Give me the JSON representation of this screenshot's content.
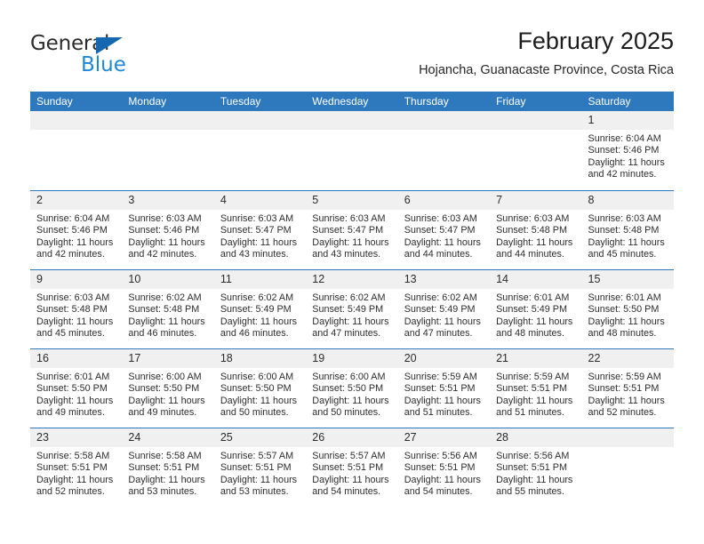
{
  "brand": {
    "name_top": "General",
    "name_bottom": "Blue",
    "triangle_icon": "triangle-icon",
    "accent_color": "#1f88d8",
    "triangle_color": "#1567b2"
  },
  "header": {
    "month_title": "February 2025",
    "location": "Hojancha, Guanacaste Province, Costa Rica"
  },
  "calendar": {
    "header_bg": "#2e79be",
    "day_band_bg": "#f0f0f0",
    "weekdays": [
      "Sunday",
      "Monday",
      "Tuesday",
      "Wednesday",
      "Thursday",
      "Friday",
      "Saturday"
    ],
    "weeks": [
      [
        {
          "empty": true
        },
        {
          "empty": true
        },
        {
          "empty": true
        },
        {
          "empty": true
        },
        {
          "empty": true
        },
        {
          "empty": true
        },
        {
          "day": "1",
          "sunrise": "Sunrise: 6:04 AM",
          "sunset": "Sunset: 5:46 PM",
          "daylight": "Daylight: 11 hours and 42 minutes."
        }
      ],
      [
        {
          "day": "2",
          "sunrise": "Sunrise: 6:04 AM",
          "sunset": "Sunset: 5:46 PM",
          "daylight": "Daylight: 11 hours and 42 minutes."
        },
        {
          "day": "3",
          "sunrise": "Sunrise: 6:03 AM",
          "sunset": "Sunset: 5:46 PM",
          "daylight": "Daylight: 11 hours and 42 minutes."
        },
        {
          "day": "4",
          "sunrise": "Sunrise: 6:03 AM",
          "sunset": "Sunset: 5:47 PM",
          "daylight": "Daylight: 11 hours and 43 minutes."
        },
        {
          "day": "5",
          "sunrise": "Sunrise: 6:03 AM",
          "sunset": "Sunset: 5:47 PM",
          "daylight": "Daylight: 11 hours and 43 minutes."
        },
        {
          "day": "6",
          "sunrise": "Sunrise: 6:03 AM",
          "sunset": "Sunset: 5:47 PM",
          "daylight": "Daylight: 11 hours and 44 minutes."
        },
        {
          "day": "7",
          "sunrise": "Sunrise: 6:03 AM",
          "sunset": "Sunset: 5:48 PM",
          "daylight": "Daylight: 11 hours and 44 minutes."
        },
        {
          "day": "8",
          "sunrise": "Sunrise: 6:03 AM",
          "sunset": "Sunset: 5:48 PM",
          "daylight": "Daylight: 11 hours and 45 minutes."
        }
      ],
      [
        {
          "day": "9",
          "sunrise": "Sunrise: 6:03 AM",
          "sunset": "Sunset: 5:48 PM",
          "daylight": "Daylight: 11 hours and 45 minutes."
        },
        {
          "day": "10",
          "sunrise": "Sunrise: 6:02 AM",
          "sunset": "Sunset: 5:48 PM",
          "daylight": "Daylight: 11 hours and 46 minutes."
        },
        {
          "day": "11",
          "sunrise": "Sunrise: 6:02 AM",
          "sunset": "Sunset: 5:49 PM",
          "daylight": "Daylight: 11 hours and 46 minutes."
        },
        {
          "day": "12",
          "sunrise": "Sunrise: 6:02 AM",
          "sunset": "Sunset: 5:49 PM",
          "daylight": "Daylight: 11 hours and 47 minutes."
        },
        {
          "day": "13",
          "sunrise": "Sunrise: 6:02 AM",
          "sunset": "Sunset: 5:49 PM",
          "daylight": "Daylight: 11 hours and 47 minutes."
        },
        {
          "day": "14",
          "sunrise": "Sunrise: 6:01 AM",
          "sunset": "Sunset: 5:49 PM",
          "daylight": "Daylight: 11 hours and 48 minutes."
        },
        {
          "day": "15",
          "sunrise": "Sunrise: 6:01 AM",
          "sunset": "Sunset: 5:50 PM",
          "daylight": "Daylight: 11 hours and 48 minutes."
        }
      ],
      [
        {
          "day": "16",
          "sunrise": "Sunrise: 6:01 AM",
          "sunset": "Sunset: 5:50 PM",
          "daylight": "Daylight: 11 hours and 49 minutes."
        },
        {
          "day": "17",
          "sunrise": "Sunrise: 6:00 AM",
          "sunset": "Sunset: 5:50 PM",
          "daylight": "Daylight: 11 hours and 49 minutes."
        },
        {
          "day": "18",
          "sunrise": "Sunrise: 6:00 AM",
          "sunset": "Sunset: 5:50 PM",
          "daylight": "Daylight: 11 hours and 50 minutes."
        },
        {
          "day": "19",
          "sunrise": "Sunrise: 6:00 AM",
          "sunset": "Sunset: 5:50 PM",
          "daylight": "Daylight: 11 hours and 50 minutes."
        },
        {
          "day": "20",
          "sunrise": "Sunrise: 5:59 AM",
          "sunset": "Sunset: 5:51 PM",
          "daylight": "Daylight: 11 hours and 51 minutes."
        },
        {
          "day": "21",
          "sunrise": "Sunrise: 5:59 AM",
          "sunset": "Sunset: 5:51 PM",
          "daylight": "Daylight: 11 hours and 51 minutes."
        },
        {
          "day": "22",
          "sunrise": "Sunrise: 5:59 AM",
          "sunset": "Sunset: 5:51 PM",
          "daylight": "Daylight: 11 hours and 52 minutes."
        }
      ],
      [
        {
          "day": "23",
          "sunrise": "Sunrise: 5:58 AM",
          "sunset": "Sunset: 5:51 PM",
          "daylight": "Daylight: 11 hours and 52 minutes."
        },
        {
          "day": "24",
          "sunrise": "Sunrise: 5:58 AM",
          "sunset": "Sunset: 5:51 PM",
          "daylight": "Daylight: 11 hours and 53 minutes."
        },
        {
          "day": "25",
          "sunrise": "Sunrise: 5:57 AM",
          "sunset": "Sunset: 5:51 PM",
          "daylight": "Daylight: 11 hours and 53 minutes."
        },
        {
          "day": "26",
          "sunrise": "Sunrise: 5:57 AM",
          "sunset": "Sunset: 5:51 PM",
          "daylight": "Daylight: 11 hours and 54 minutes."
        },
        {
          "day": "27",
          "sunrise": "Sunrise: 5:56 AM",
          "sunset": "Sunset: 5:51 PM",
          "daylight": "Daylight: 11 hours and 54 minutes."
        },
        {
          "day": "28",
          "sunrise": "Sunrise: 5:56 AM",
          "sunset": "Sunset: 5:51 PM",
          "daylight": "Daylight: 11 hours and 55 minutes."
        },
        {
          "empty": true
        }
      ]
    ]
  }
}
